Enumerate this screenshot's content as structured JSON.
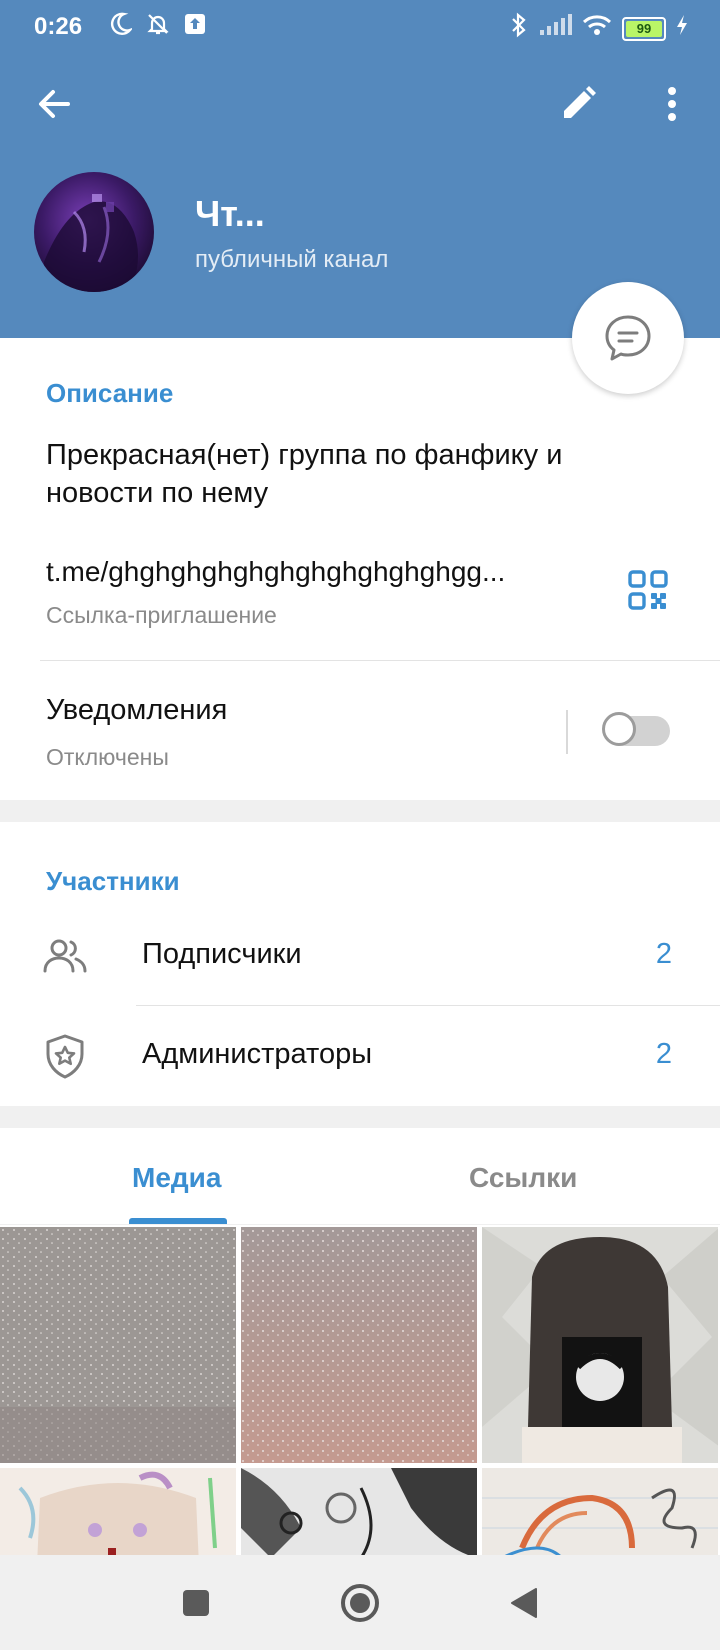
{
  "status_bar": {
    "time": "0:26",
    "battery_level": "99",
    "icons": [
      "moon-icon",
      "bell-off-icon",
      "upload-icon",
      "bluetooth-icon",
      "signal-icon",
      "wifi-icon",
      "charging-icon"
    ]
  },
  "app_bar": {
    "back_icon": "arrow-left-icon",
    "edit_icon": "pencil-icon",
    "more_icon": "more-vert-icon"
  },
  "channel": {
    "title": "Чт...",
    "subtitle": "публичный канал"
  },
  "info": {
    "section_title": "Описание",
    "description": "Прекрасная(нет) группа по фанфику и новости по нему",
    "link": "t.me/ghghghghghghghghghghghgg...",
    "link_caption": "Ссылка-приглашение",
    "notifications_title": "Уведомления",
    "notifications_status": "Отключены",
    "notifications_enabled": false
  },
  "members": {
    "section_title": "Участники",
    "rows": [
      {
        "label": "Подписчики",
        "count": "2",
        "icon": "users-icon"
      },
      {
        "label": "Администраторы",
        "count": "2",
        "icon": "shield-star-icon"
      }
    ]
  },
  "tabs": [
    {
      "label": "Медиа",
      "active": true
    },
    {
      "label": "Ссылки",
      "active": false
    }
  ],
  "colors": {
    "header": "#5589bd",
    "accent": "#3a8ed1"
  }
}
